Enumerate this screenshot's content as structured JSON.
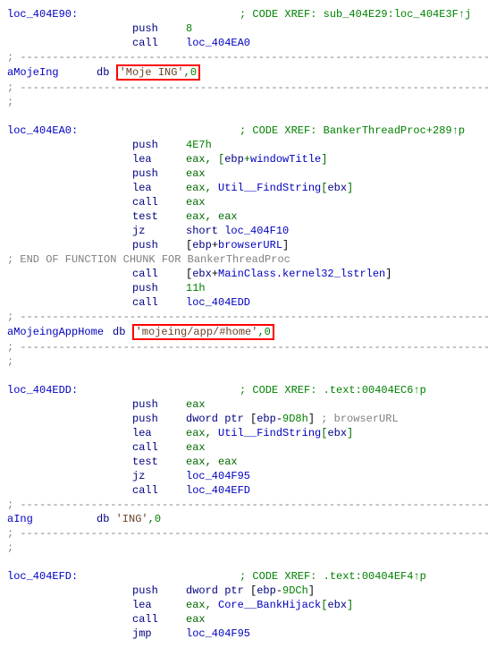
{
  "sections": {
    "sec1": {
      "label": "loc_404E90:",
      "xref": "; CODE XREF: sub_404E29:loc_404E3F↑j",
      "lines": [
        {
          "mnem": "push",
          "op": "8"
        },
        {
          "mnem": "call",
          "op": "loc_404EA0"
        }
      ]
    },
    "aMojeIng": {
      "label": "aMojeIng",
      "db": "db",
      "str": "'Moje ING'",
      "term": ",0"
    },
    "sec2": {
      "label": "loc_404EA0:",
      "xref": "; CODE XREF: BankerThreadProc+289↑p",
      "lines": [
        {
          "mnem": "push",
          "op": "4E7h"
        },
        {
          "mnem": "lea",
          "op": "eax, [ebp+windowTitle]"
        },
        {
          "mnem": "push",
          "op": "eax"
        },
        {
          "mnem": "lea",
          "op": "eax, Util__FindString[ebx]"
        },
        {
          "mnem": "call",
          "op": "eax"
        },
        {
          "mnem": "test",
          "op": "eax, eax"
        },
        {
          "mnem": "jz",
          "op": "short loc_404F10"
        },
        {
          "mnem": "push",
          "op": "[ebp+browserURL]"
        }
      ],
      "endchunk": "; END OF FUNCTION CHUNK FOR BankerThreadProc",
      "lines2": [
        {
          "mnem": "call",
          "op": "[ebx+MainClass.kernel32_lstrlen]"
        },
        {
          "mnem": "push",
          "op": "11h"
        },
        {
          "mnem": "call",
          "op": "loc_404EDD"
        }
      ]
    },
    "aMojeingAppHome": {
      "label": "aMojeingAppHome",
      "db": "db",
      "str": "'mojeing/app/#home'",
      "term": ",0"
    },
    "sec3": {
      "label": "loc_404EDD:",
      "xref": "; CODE XREF: .text:00404EC6↑p",
      "lines": [
        {
          "mnem": "push",
          "op": "eax"
        },
        {
          "mnem": "push",
          "op": "dword ptr [ebp-9D8h] ; browserURL"
        },
        {
          "mnem": "lea",
          "op": "eax, Util__FindString[ebx]"
        },
        {
          "mnem": "call",
          "op": "eax"
        },
        {
          "mnem": "test",
          "op": "eax, eax"
        },
        {
          "mnem": "jz",
          "op": "loc_404F95"
        },
        {
          "mnem": "call",
          "op": "loc_404EFD"
        }
      ]
    },
    "aIng": {
      "label": "aIng",
      "db": "db",
      "str": "'ING'",
      "term": ",0"
    },
    "sec4": {
      "label": "loc_404EFD:",
      "xref": "; CODE XREF: .text:00404EF4↑p",
      "lines": [
        {
          "mnem": "push",
          "op": "dword ptr [ebp-9DCh]"
        },
        {
          "mnem": "lea",
          "op": "eax, Core__BankHijack[ebx]"
        },
        {
          "mnem": "call",
          "op": "eax"
        },
        {
          "mnem": "jmp",
          "op": "loc_404F95"
        }
      ]
    }
  },
  "sep": "; ---------------------------------------------------------------------------",
  "semi": ";"
}
